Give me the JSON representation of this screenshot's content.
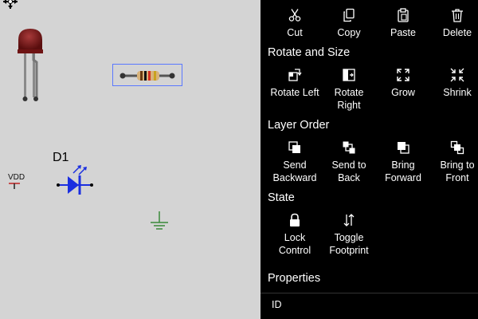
{
  "canvas": {
    "led_label": "D1",
    "vdd_label": "VDD"
  },
  "panel": {
    "clipboard": [
      {
        "label": "Cut",
        "icon": "scissors-icon"
      },
      {
        "label": "Copy",
        "icon": "copy-icon"
      },
      {
        "label": "Paste",
        "icon": "paste-icon"
      },
      {
        "label": "Delete",
        "icon": "trash-icon"
      }
    ],
    "rotate_section": "Rotate and Size",
    "rotate": [
      {
        "label": "Rotate Left",
        "icon": "rotate-left-icon"
      },
      {
        "label": "Rotate\nRight",
        "icon": "rotate-right-icon"
      },
      {
        "label": "Grow",
        "icon": "grow-icon"
      },
      {
        "label": "Shrink",
        "icon": "shrink-icon"
      }
    ],
    "layer_section": "Layer Order",
    "layer": [
      {
        "label": "Send\nBackward",
        "icon": "send-backward-icon"
      },
      {
        "label": "Send to\nBack",
        "icon": "send-to-back-icon"
      },
      {
        "label": "Bring\nForward",
        "icon": "bring-forward-icon"
      },
      {
        "label": "Bring to\nFront",
        "icon": "bring-to-front-icon"
      }
    ],
    "state_section": "State",
    "state": [
      {
        "label": "Lock\nControl",
        "icon": "lock-icon"
      },
      {
        "label": "Toggle\nFootprint",
        "icon": "toggle-footprint-icon"
      }
    ],
    "properties_section": "Properties",
    "id_label": "ID"
  },
  "colors": {
    "canvas_bg": "#d4d4d4",
    "panel_bg": "#000000",
    "selection": "#5a78ff",
    "diode_blue": "#1a2ee0",
    "ground_green": "#3a8a3a",
    "led_red": "#7a1a1a"
  }
}
